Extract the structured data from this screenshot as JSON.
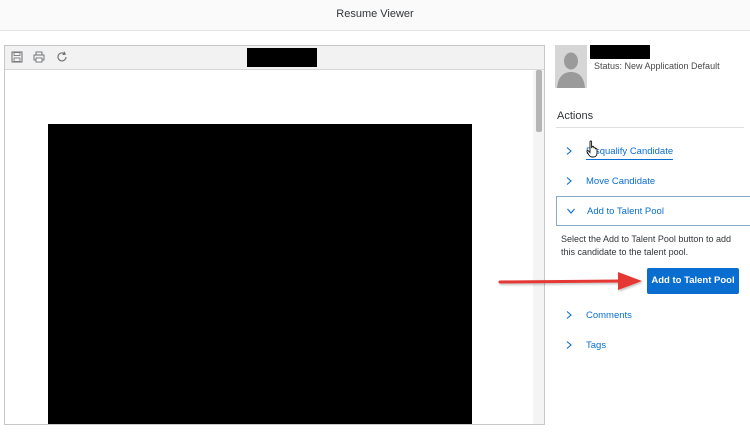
{
  "header": {
    "title": "Resume Viewer"
  },
  "viewer": {
    "toolbar": {
      "icons": [
        "save-icon",
        "print-icon",
        "refresh-icon"
      ]
    }
  },
  "candidate": {
    "status": "Status: New Application Default"
  },
  "actions": {
    "heading": "Actions",
    "items": [
      {
        "label": "Disqualify Candidate",
        "expanded": false
      },
      {
        "label": "Move Candidate",
        "expanded": false
      },
      {
        "label": "Add to Talent Pool",
        "expanded": true
      },
      {
        "label": "Comments",
        "expanded": false
      },
      {
        "label": "Tags",
        "expanded": false
      }
    ],
    "talent_pool": {
      "description": "Select the Add to Talent Pool button to add this candidate to the talent pool.",
      "button_label": "Add to Talent Pool"
    }
  },
  "colors": {
    "link": "#0a6ed1",
    "button_bg": "#0a6ed1",
    "annotation_arrow": "#e53935"
  }
}
